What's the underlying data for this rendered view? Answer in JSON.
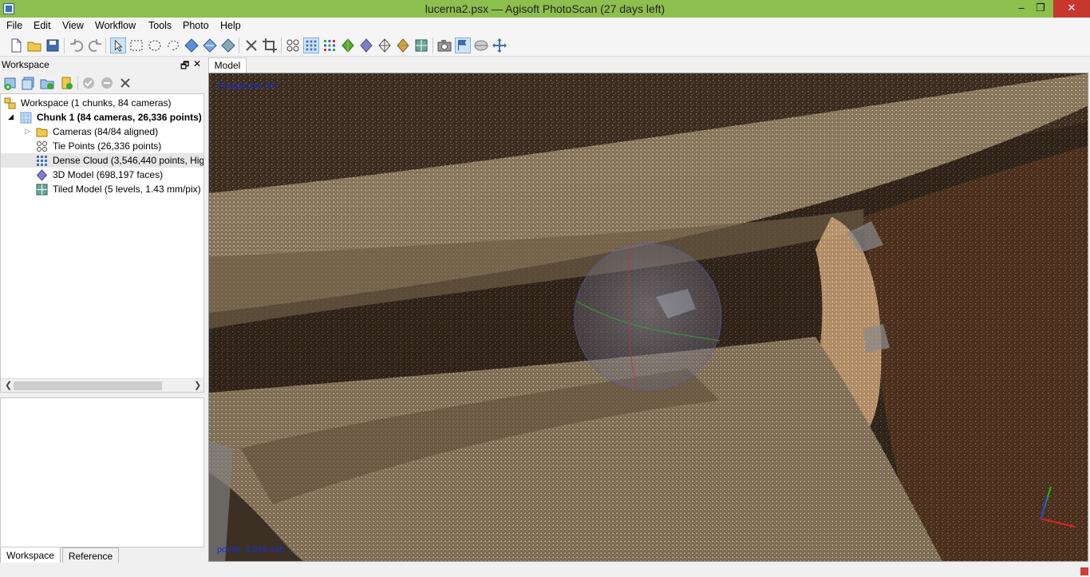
{
  "window": {
    "title": "lucerna2.psx — Agisoft PhotoScan (27 days left)",
    "minimize": "–",
    "maximize": "❐",
    "close": "✕"
  },
  "menu": [
    "File",
    "Edit",
    "View",
    "Workflow",
    "Tools",
    "Photo",
    "Help"
  ],
  "toolbar_icons": [
    "new-icon",
    "open-icon",
    "save-icon",
    "undo-icon",
    "redo-icon",
    "select-icon",
    "rect-select-icon",
    "circle-select-icon",
    "free-select-icon",
    "move-object-icon",
    "rotate-object-icon",
    "scale-object-icon",
    "delete-icon",
    "crop-icon",
    "tie-points-icon",
    "dense-cloud-icon",
    "dense-cloud-classes-icon",
    "shaded-model-icon",
    "solid-model-icon",
    "wireframe-model-icon",
    "textured-model-icon",
    "tiled-model-icon",
    "show-cameras-icon",
    "show-region-icon",
    "show-trackball-icon",
    "reset-view-icon"
  ],
  "workspace": {
    "panel_title": "Workspace",
    "restore": "🗗",
    "close": "✕",
    "tree": [
      {
        "label": "Workspace (1 chunks, 84 cameras)"
      },
      {
        "label": "Chunk 1 (84 cameras, 26,336 points)"
      },
      {
        "label": "Cameras (84/84 aligned)"
      },
      {
        "label": "Tie Points (26,336 points)"
      },
      {
        "label": "Dense Cloud (3,546,440 points, High"
      },
      {
        "label": "3D Model (698,197 faces)"
      },
      {
        "label": "Tiled Model (5 levels, 1.43 mm/pix)"
      }
    ],
    "tabs": [
      "Workspace",
      "Reference"
    ]
  },
  "model": {
    "tab": "Model",
    "projection": "Perspective 30°",
    "points": "points: 3,546,440"
  },
  "colors": {
    "title_bar": "#8cbf4e",
    "close_button": "#c7372d",
    "overlay_text": "#1a2fd0"
  }
}
